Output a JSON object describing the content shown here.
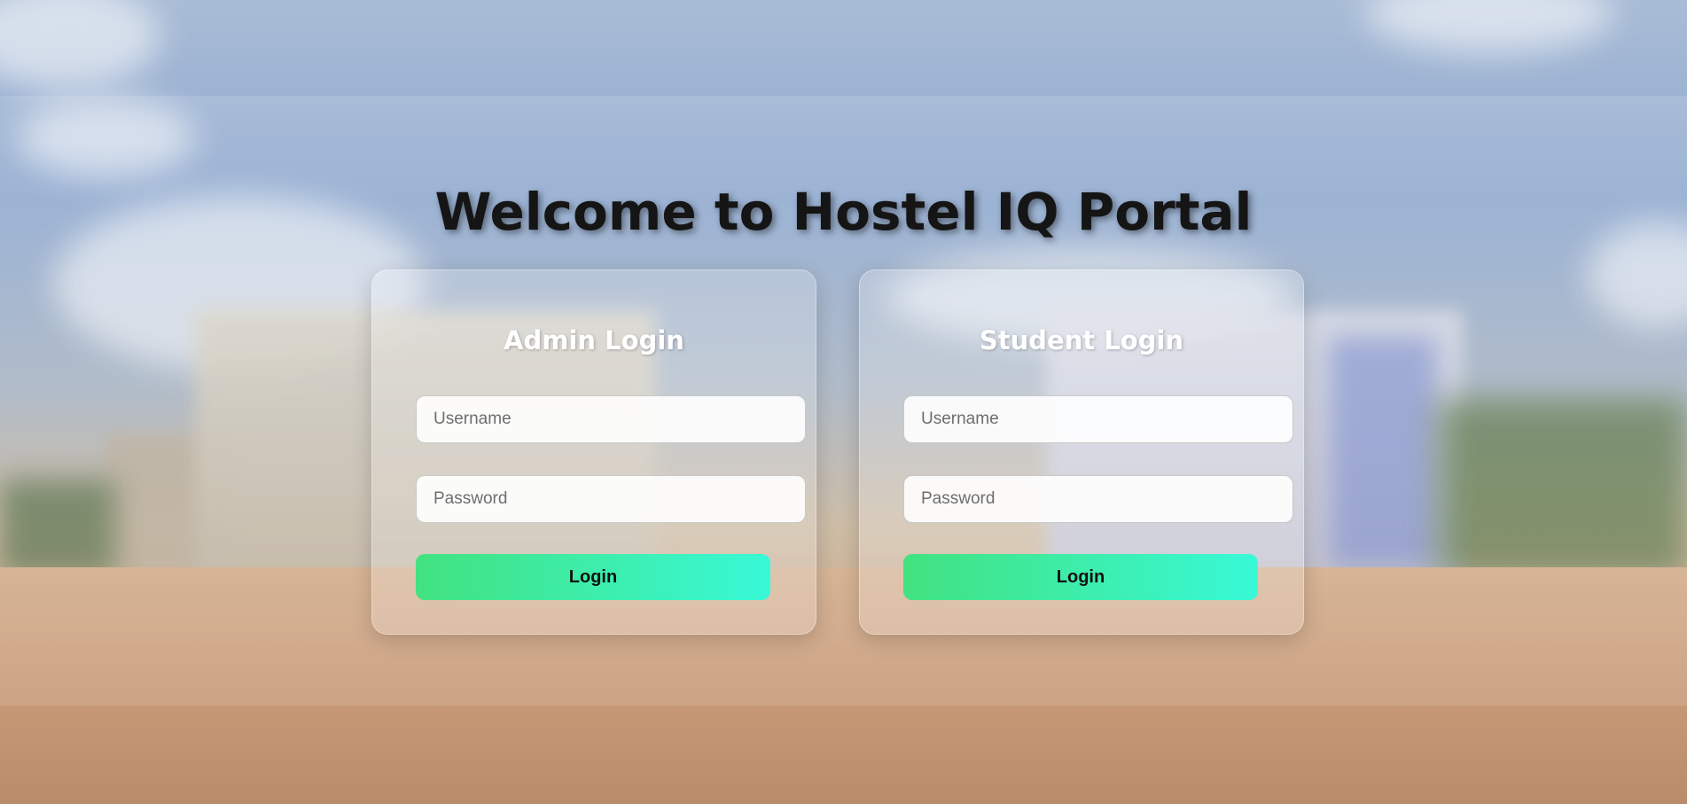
{
  "page": {
    "title": "Welcome to Hostel IQ Portal"
  },
  "admin": {
    "heading": "Admin Login",
    "username_placeholder": "Username",
    "password_placeholder": "Password",
    "login_label": "Login"
  },
  "student": {
    "heading": "Student Login",
    "username_placeholder": "Username",
    "password_placeholder": "Password",
    "login_label": "Login"
  },
  "colors": {
    "button_gradient_start": "#42e27f",
    "button_gradient_end": "#38f9d7",
    "heading_text": "#ffffff",
    "title_text": "#151515"
  }
}
